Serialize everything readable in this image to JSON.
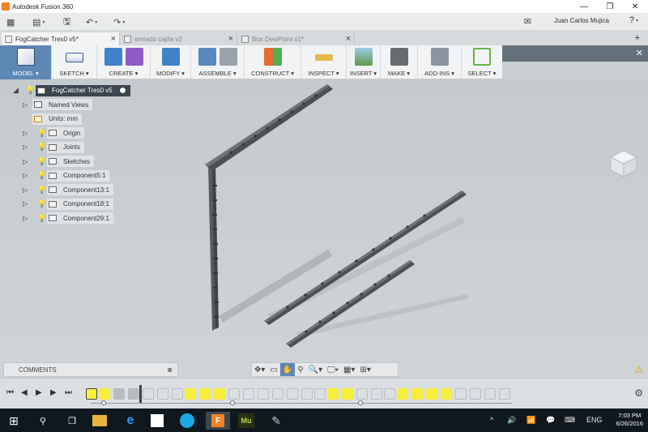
{
  "app": {
    "title": "Autodesk Fusion 360",
    "min_glyph": "—",
    "max_glyph": "❐",
    "close_glyph": "✕"
  },
  "qat": {
    "grid_glyph": "▦",
    "file_glyph": "▤",
    "save_glyph": "🖫",
    "undo_glyph": "↶",
    "redo_glyph": "↷",
    "caret": "▾",
    "message_glyph": "✉",
    "user_name": "Juan Carlos Mujica",
    "help_glyph": "?"
  },
  "tabs": [
    {
      "label": "FogCatcher Tres0 v5*",
      "active": true
    },
    {
      "label": "armado cajita v2",
      "active": false
    },
    {
      "label": "Box DewPoint v1*",
      "active": false
    }
  ],
  "tab_close_glyph": "×",
  "tab_add_glyph": "+",
  "ribbon": {
    "workspace": "MODEL ▾",
    "groups": [
      {
        "label": "SKETCH ▾"
      },
      {
        "label": "CREATE ▾"
      },
      {
        "label": "MODIFY ▾"
      },
      {
        "label": "ASSEMBLE ▾"
      },
      {
        "label": "CONSTRUCT ▾"
      },
      {
        "label": "INSPECT ▾"
      },
      {
        "label": "INSERT ▾"
      },
      {
        "label": "MAKE ▾"
      },
      {
        "label": "ADD-INS ▾"
      },
      {
        "label": "SELECT ▾"
      }
    ],
    "close_glyph": "✕"
  },
  "browser": {
    "root": "FogCatcher Tres0 v5",
    "collapse_glyph": "◢",
    "expand_glyph": "▷",
    "bulb_glyph": "💡",
    "items": [
      {
        "label": "Named Views",
        "bulb": "none"
      },
      {
        "label": "Units: mm",
        "bulb": "none"
      },
      {
        "label": "Origin",
        "bulb": "off"
      },
      {
        "label": "Joints",
        "bulb": "on"
      },
      {
        "label": "Sketches",
        "bulb": "on"
      },
      {
        "label": "Component5:1",
        "bulb": "on"
      },
      {
        "label": "Component13:1",
        "bulb": "on"
      },
      {
        "label": "Component18:1",
        "bulb": "on"
      },
      {
        "label": "Component29:1",
        "bulb": "on"
      }
    ]
  },
  "comments": {
    "label": "COMMENTS",
    "add_glyph": "⊕"
  },
  "navbar": {
    "orbit": "✥▾",
    "look": "▭",
    "pan": "✋",
    "zoom_window": "⚲",
    "zoom": "🔍▾",
    "display": "🖵▾",
    "grid": "▦▾",
    "viewports": "⊞▾"
  },
  "warning_glyph": "⚠",
  "timeline": {
    "first": "⏮",
    "prev": "◀",
    "play": "▶",
    "next": "▶",
    "last": "⏭",
    "gear": "⚙"
  },
  "taskbar": {
    "start": "⊞",
    "search": "⚲",
    "task_view": "❐",
    "fusion_label": "F",
    "muse_label": "Mu",
    "language": "ENG",
    "time": "7:03 PM",
    "date": "6/26/2016",
    "tray_up": "^",
    "volume": "🔊",
    "network": "📶",
    "notifications": "💬",
    "keyboard": "⌨"
  },
  "colors": {
    "accent": "#5d87b5",
    "highlight": "#f7ee3b",
    "part": "#4a5054"
  }
}
